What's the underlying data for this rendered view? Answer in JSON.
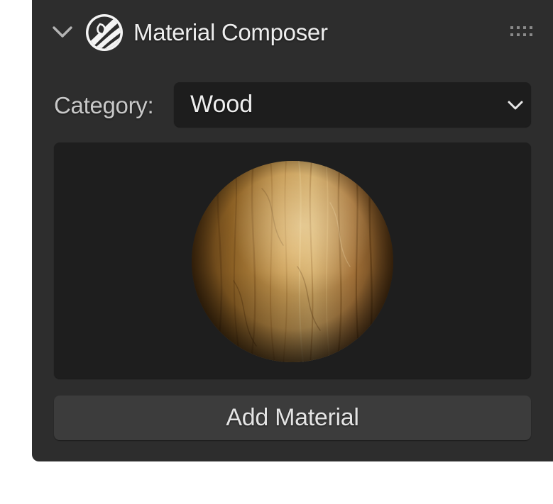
{
  "panel": {
    "title": "Material Composer",
    "collapse_icon": "chevron-down-icon",
    "logo_icon": "material-composer-logo-icon",
    "drag_handle_icon": "drag-handle-icon",
    "colors": {
      "panel_bg": "#2d2d2d",
      "field_bg": "#1d1d1d",
      "button_bg": "#3c3c3c",
      "text": "#eeeeee"
    }
  },
  "category": {
    "label": "Category:",
    "selected": "Wood",
    "dropdown_icon": "chevron-down-icon"
  },
  "preview": {
    "material": "Wood"
  },
  "actions": {
    "add_label": "Add Material"
  }
}
